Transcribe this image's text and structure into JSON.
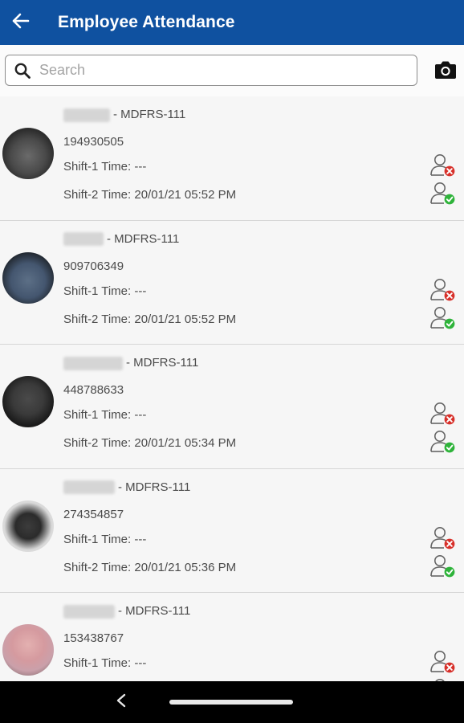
{
  "appbar": {
    "title": "Employee Attendance",
    "back_icon": "arrow-left-icon"
  },
  "search": {
    "placeholder": "Search",
    "value": "",
    "search_icon": "magnifier-icon",
    "camera_icon": "camera-icon"
  },
  "colors": {
    "primary": "#0f51a0",
    "present": "#2eb33a",
    "absent": "#d7302a"
  },
  "employees": [
    {
      "unit": "- MDFRS-111",
      "id": "194930505",
      "shift1": "Shift-1 Time: ---",
      "shift2": "Shift-2 Time: 20/01/21 05:52 PM"
    },
    {
      "unit": "- MDFRS-111",
      "id": "909706349",
      "shift1": "Shift-1 Time: ---",
      "shift2": "Shift-2 Time: 20/01/21 05:52 PM"
    },
    {
      "unit": "- MDFRS-111",
      "id": "448788633",
      "shift1": "Shift-1 Time: ---",
      "shift2": "Shift-2 Time: 20/01/21 05:34 PM"
    },
    {
      "unit": "- MDFRS-111",
      "id": "274354857",
      "shift1": "Shift-1 Time: ---",
      "shift2": "Shift-2 Time: 20/01/21 05:36 PM"
    },
    {
      "unit": "- MDFRS-111",
      "id": "153438767",
      "shift1": "Shift-1 Time: ---",
      "shift2": ""
    }
  ],
  "navbar": {
    "back_icon": "nav-back-icon",
    "home_icon": "home-pill-icon"
  }
}
